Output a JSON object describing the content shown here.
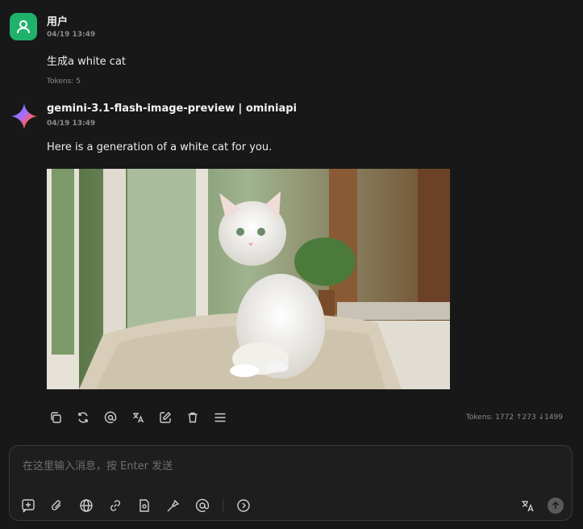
{
  "user_message": {
    "name": "用户",
    "time": "04/19 13:49",
    "text": "生成a white cat",
    "tokens": "Tokens: 5"
  },
  "ai_message": {
    "name": "gemini-3.1-flash-image-preview | ominiapi",
    "time": "04/19 13:49",
    "text": "Here is a generation of a white cat for you.",
    "tokens": "Tokens: 1772 ↑273 ↓1499",
    "image_icon": "generated-image-white-cat"
  },
  "message_actions": [
    "copy-icon",
    "regenerate-icon",
    "mention-icon",
    "translate-icon",
    "edit-icon",
    "delete-icon",
    "menu-icon"
  ],
  "composer": {
    "placeholder": "在这里输入消息，按 Enter 发送",
    "tools": [
      "new-topic-icon",
      "attachment-icon",
      "web-search-icon",
      "link-icon",
      "knowledge-icon",
      "tools-icon",
      "mention-icon",
      "more-icon"
    ],
    "right_tools": [
      "translate-icon",
      "send-icon"
    ]
  },
  "colors": {
    "background": "#181818",
    "user_avatar": "#20b26b"
  }
}
